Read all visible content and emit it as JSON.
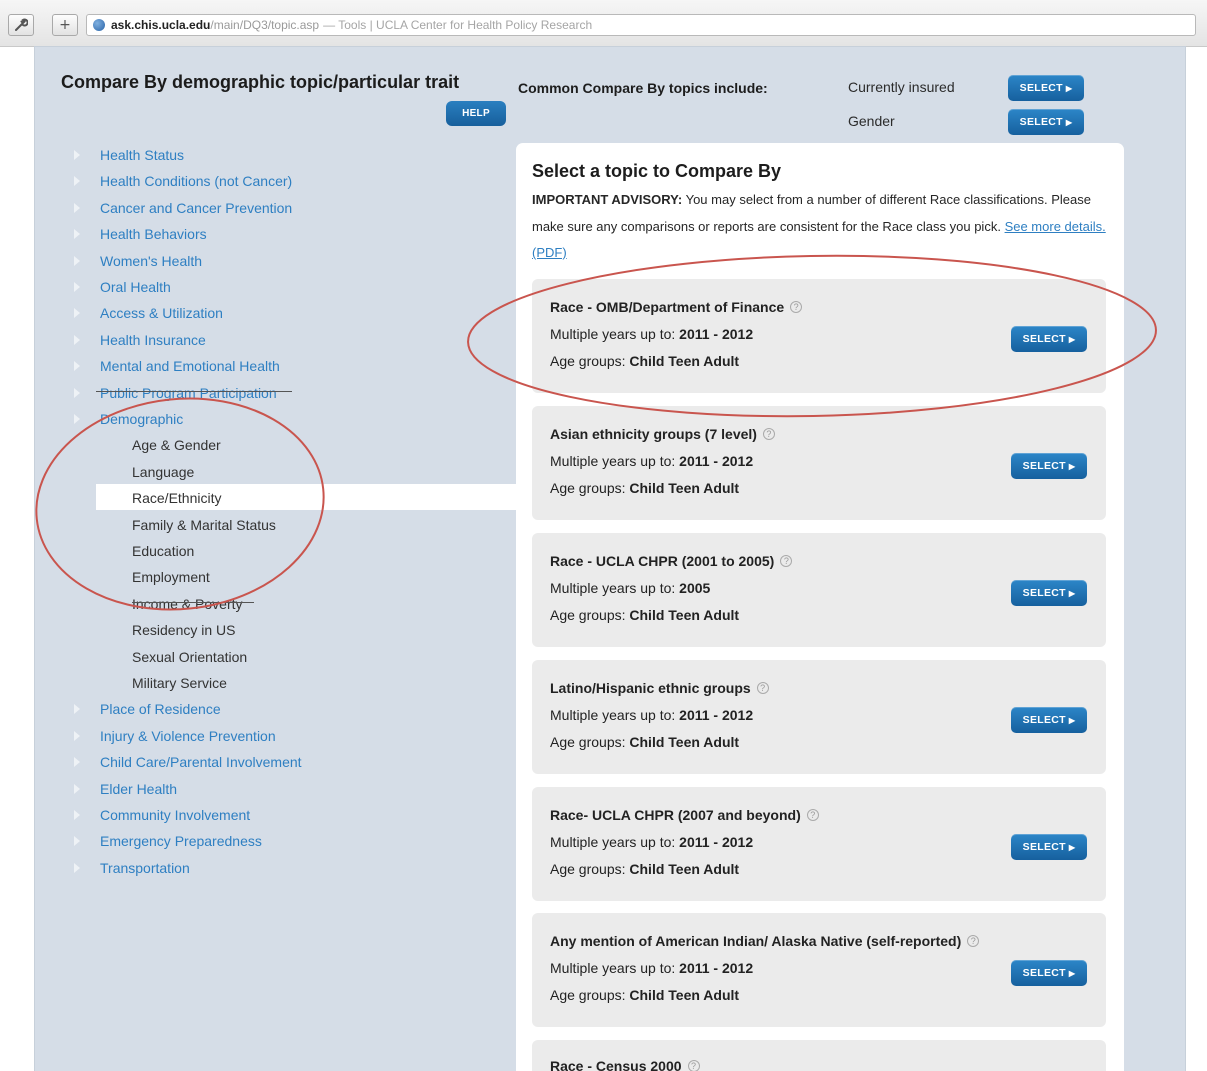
{
  "browser": {
    "url_domain": "ask.chis.ucla.edu",
    "url_path": "/main/DQ3/topic.asp",
    "page_title": "— Tools | UCLA Center for Health Policy Research",
    "back_icon": "wrench-icon",
    "new_tab_icon": "plus-icon"
  },
  "header": {
    "title": "Compare By demographic topic/particular trait",
    "help_label": "HELP",
    "common_label": "Common Compare By topics include:",
    "common_items": [
      {
        "label": "Currently insured",
        "button": "SELECT"
      },
      {
        "label": "Gender",
        "button": "SELECT"
      }
    ]
  },
  "nav": {
    "items_top": [
      "Health Status",
      "Health Conditions (not Cancer)",
      "Cancer and Cancer Prevention",
      "Health Behaviors",
      "Women's Health",
      "Oral Health",
      "Access & Utilization",
      "Health Insurance",
      "Mental and Emotional Health",
      "Public Program Participation",
      "Demographic"
    ],
    "sub_items": [
      "Age & Gender",
      "Language",
      "Race/Ethnicity",
      "Family & Marital Status",
      "Education",
      "Employment",
      "Income & Poverty",
      "Residency in US",
      "Sexual Orientation",
      "Military Service"
    ],
    "active_sub": "Race/Ethnicity",
    "items_bottom": [
      "Place of Residence",
      "Injury & Violence Prevention",
      "Child Care/Parental Involvement",
      "Elder Health",
      "Community Involvement",
      "Emergency Preparedness",
      "Transportation"
    ]
  },
  "panel": {
    "title": "Select a topic to Compare By",
    "advisory_label": "IMPORTANT ADVISORY:",
    "advisory_text": " You may select from a number of different Race classifications. Please make sure any comparisons or reports are consistent for the Race class you pick.",
    "details_link": "See more details. (PDF)",
    "years_prefix": "Multiple years up to: ",
    "age_prefix": "Age groups: ",
    "select_label": "SELECT",
    "cards": [
      {
        "title": "Race - OMB/Department of Finance",
        "years": "2011 - 2012",
        "ages": "Child Teen Adult"
      },
      {
        "title": "Asian ethnicity groups (7 level)",
        "years": "2011 - 2012",
        "ages": "Child Teen Adult"
      },
      {
        "title": "Race - UCLA CHPR (2001 to 2005)",
        "years": "2005",
        "ages": "Child Teen Adult"
      },
      {
        "title": "Latino/Hispanic ethnic groups",
        "years": "2011 - 2012",
        "ages": "Child Teen Adult"
      },
      {
        "title": "Race- UCLA CHPR (2007 and beyond)",
        "years": "2011 - 2012",
        "ages": "Child Teen Adult"
      },
      {
        "title": "Any mention of American Indian/ Alaska Native (self-reported)",
        "years": "2011 - 2012",
        "ages": "Child Teen Adult"
      },
      {
        "title": "Race - Census 2000",
        "years": "",
        "ages": ""
      }
    ]
  },
  "colors": {
    "page_bg": "#d5dde7",
    "link": "#2e7fc2",
    "button": "#1a6aa8",
    "annotation": "#c9554e"
  }
}
